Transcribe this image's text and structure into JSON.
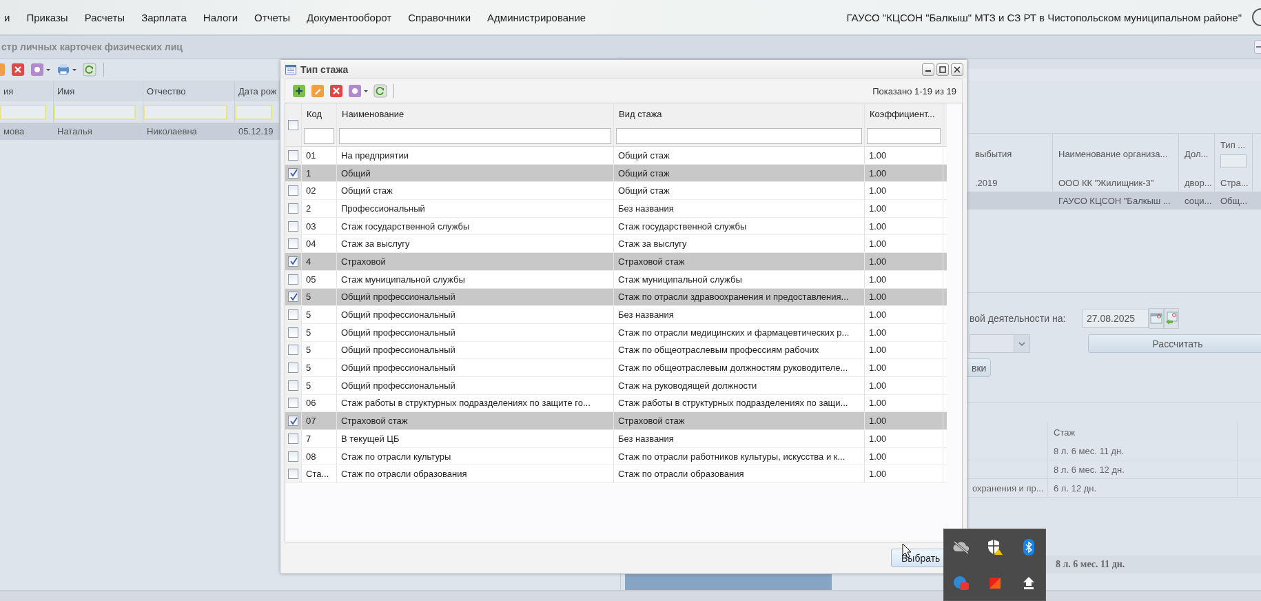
{
  "menu": [
    {
      "label": "и"
    },
    {
      "label": "Приказы"
    },
    {
      "label": "Расчеты"
    },
    {
      "label": "Зарплата"
    },
    {
      "label": "Налоги"
    },
    {
      "label": "Отчеты"
    },
    {
      "label": "Документооборот"
    },
    {
      "label": "Справочники"
    },
    {
      "label": "Администрирование"
    }
  ],
  "organization": "ГАУСО \"КЦСОН \"Балкыш\" МТЗ и СЗ РТ в Чистопольском муниципальном районе\"",
  "registry": {
    "title": "стр личных карточек физических лиц",
    "columns": [
      "ия",
      "Имя",
      "Отчество",
      "Дата рож"
    ],
    "rows": [
      {
        "cells": [
          "мова",
          "Наталья",
          "Николаевна",
          "05.12.19"
        ],
        "selected": true
      }
    ]
  },
  "work_history": {
    "columns": {
      "end_date": "выбытия",
      "organization": "Наименование организа...",
      "position": "Дол...",
      "type": "Тип ..."
    },
    "rows": [
      {
        "end_date": ".2019",
        "organization": "ООО КК \"Жилищник-3\"",
        "position": "двор...",
        "type": "Стра...",
        "selected": false
      },
      {
        "organization": "ГАУСО КЦСОН \"Балкыш ...",
        "position": "соци...",
        "type": "Общ...",
        "selected": true
      }
    ]
  },
  "calculation": {
    "label": "вой деятельности на:",
    "date": "27.08.2025",
    "button": "Рассчитать",
    "second_button": "вки"
  },
  "seniority": {
    "column": "Стаж",
    "rows": [
      {
        "duration": "8 л. 6 мес. 11 дн."
      },
      {
        "duration": "8 л. 6 мес. 12 дн."
      },
      {
        "type": "охранения и пр...",
        "duration": "6 л. 12 дн."
      }
    ],
    "total": "8 л. 6 мес. 11 дн."
  },
  "dialog": {
    "title": "Тип стажа",
    "all_checked": false,
    "paging": "Показано 1-19 из 19",
    "columns": [
      "Код",
      "Наименование",
      "Вид стажа",
      "Коэффициент..."
    ],
    "rows": [
      {
        "code": "01",
        "name": "На предприятии",
        "type": "Общий стаж",
        "coefficient": "1.00",
        "checked": false
      },
      {
        "code": "1",
        "name": "Общий",
        "type": "Общий стаж",
        "coefficient": "1.00",
        "checked": true
      },
      {
        "code": "02",
        "name": "Общий стаж",
        "type": "Общий стаж",
        "coefficient": "1.00",
        "checked": false
      },
      {
        "code": "2",
        "name": "Профессиональный",
        "type": "Без названия",
        "coefficient": "1.00",
        "checked": false
      },
      {
        "code": "03",
        "name": "Стаж государственной службы",
        "type": "Стаж государственной службы",
        "coefficient": "1.00",
        "checked": false
      },
      {
        "code": "04",
        "name": "Стаж за выслугу",
        "type": "Стаж за выслугу",
        "coefficient": "1.00",
        "checked": false
      },
      {
        "code": "4",
        "name": "Страховой",
        "type": "Страховой стаж",
        "coefficient": "1.00",
        "checked": true
      },
      {
        "code": "05",
        "name": "Стаж муниципальной службы",
        "type": "Стаж муниципальной службы",
        "coefficient": "1.00",
        "checked": false
      },
      {
        "code": "5",
        "name": "Общий профессиональный",
        "type": "Стаж по отрасли здравоохранения и предоставления...",
        "coefficient": "1.00",
        "checked": true
      },
      {
        "code": "5",
        "name": "Общий профессиональный",
        "type": "Без названия",
        "coefficient": "1.00",
        "checked": false
      },
      {
        "code": "5",
        "name": "Общий профессиональный",
        "type": "Стаж по отрасли медицинских и фармацевтических р...",
        "coefficient": "1.00",
        "checked": false
      },
      {
        "code": "5",
        "name": "Общий профессиональный",
        "type": "Стаж по общеотраслевым профессиям рабочих",
        "coefficient": "1.00",
        "checked": false
      },
      {
        "code": "5",
        "name": "Общий профессиональный",
        "type": "Стаж по общеотраслевым должностям руководителе...",
        "coefficient": "1.00",
        "checked": false
      },
      {
        "code": "5",
        "name": "Общий профессиональный",
        "type": "Стаж на руководящей должности",
        "coefficient": "1.00",
        "checked": false
      },
      {
        "code": "06",
        "name": "Стаж работы в структурных подразделениях по защите го...",
        "type": "Стаж работы в структурных подразделениях по защи...",
        "coefficient": "1.00",
        "checked": false
      },
      {
        "code": "07",
        "name": "Страховой стаж",
        "type": "Страховой стаж",
        "coefficient": "1.00",
        "checked": true
      },
      {
        "code": "7",
        "name": "В текущей ЦБ",
        "type": "Без названия",
        "coefficient": "1.00",
        "checked": false
      },
      {
        "code": "08",
        "name": "Стаж по отрасли культуры",
        "type": "Стаж по отрасли работников культуры, искусства и к...",
        "coefficient": "1.00",
        "checked": false
      },
      {
        "code": "Ста...",
        "name": "Стаж по отрасли образования",
        "type": "Стаж по отрасли образования",
        "coefficient": "1.00",
        "checked": false
      }
    ],
    "button": "Выбрать"
  }
}
